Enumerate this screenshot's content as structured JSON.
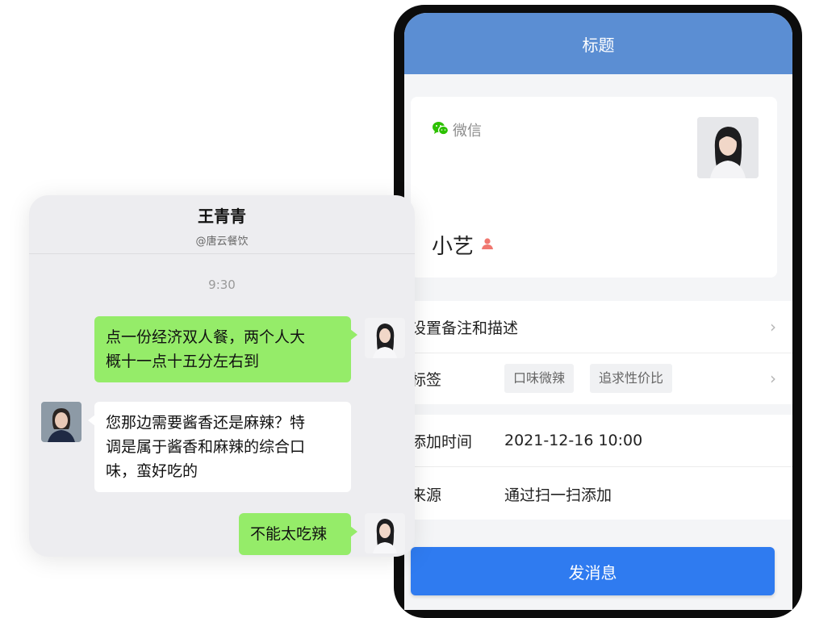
{
  "phone": {
    "title": "标题",
    "profile": {
      "source_app": "微信",
      "source_icon": "wechat-icon",
      "nickname": "小艺",
      "gender_icon": "person-icon",
      "gender_color": "#f0776f",
      "avatar": "woman-portrait-avatar"
    },
    "rows": [
      {
        "label": "设置备注和描述",
        "has_arrow": true
      },
      {
        "label": "标签",
        "tags": [
          "口味微辣",
          "追求性价比"
        ],
        "has_arrow": true
      },
      {
        "label": "添加时间",
        "value": "2021-12-16 10:00"
      },
      {
        "label": "来源",
        "value": "通过扫一扫添加"
      }
    ],
    "send_button": "发消息",
    "colors": {
      "header": "#5b8ed3",
      "button": "#2f7bf0",
      "wechat": "#2dc100"
    }
  },
  "chat": {
    "contact_name": "王青青",
    "contact_org": "@唐云餐饮",
    "time": "9:30",
    "messages": [
      {
        "side": "out",
        "text_lines": [
          "点一份经济双人餐，两个人大",
          "概十一点十五分左右到"
        ]
      },
      {
        "side": "in",
        "text_lines": [
          "您那边需要酱香还是麻辣？特",
          "调是属于酱香和麻辣的综合口",
          "味，蛮好吃的"
        ]
      },
      {
        "side": "out",
        "text_lines": [
          "不能太吃辣"
        ]
      }
    ],
    "colors": {
      "outgoing_bubble": "#95ec69",
      "incoming_bubble": "#ffffff"
    }
  }
}
